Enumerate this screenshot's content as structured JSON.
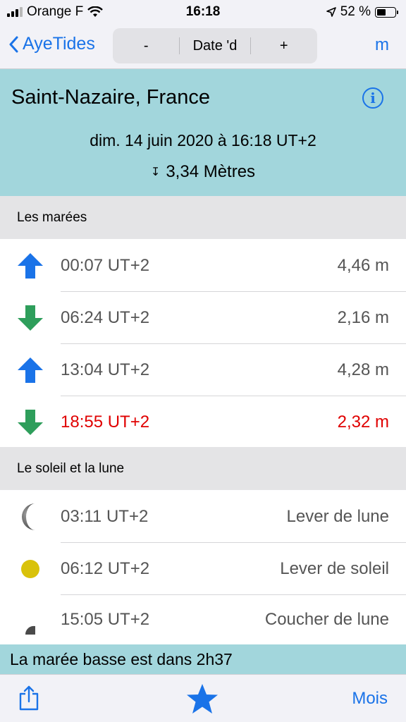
{
  "status_bar": {
    "carrier": "Orange F",
    "time": "16:18",
    "battery_percent": "52 %",
    "battery_level": 0.52
  },
  "nav": {
    "back_label": "AyeTides",
    "segments": [
      "-",
      "Date 'd",
      "+"
    ],
    "unit_label": "m"
  },
  "header": {
    "location": "Saint-Nazaire, France",
    "date": "dim. 14 juin 2020 à 16:18 UT+2",
    "height_glyph": "↧",
    "height": "3,34 Mètres"
  },
  "tides": {
    "section_title": "Les marées",
    "rows": [
      {
        "direction": "up",
        "icon": "arrow-up-icon",
        "time": "00:07 UT+2",
        "value": "4,46 m",
        "highlight": false
      },
      {
        "direction": "down",
        "icon": "arrow-down-icon",
        "time": "06:24 UT+2",
        "value": "2,16 m",
        "highlight": false
      },
      {
        "direction": "up",
        "icon": "arrow-up-icon",
        "time": "13:04 UT+2",
        "value": "4,28 m",
        "highlight": false
      },
      {
        "direction": "down",
        "icon": "arrow-down-icon",
        "time": "18:55 UT+2",
        "value": "2,32 m",
        "highlight": true
      }
    ]
  },
  "sun_moon": {
    "section_title": "Le soleil et la lune",
    "rows": [
      {
        "icon": "moon-icon",
        "time": "03:11 UT+2",
        "label": "Lever de lune"
      },
      {
        "icon": "sun-icon",
        "time": "06:12 UT+2",
        "label": "Lever de soleil"
      },
      {
        "icon": "moon-set-icon",
        "time": "15:05 UT+2",
        "label": "Coucher de lune"
      }
    ]
  },
  "banner": "La marée basse est dans 2h37",
  "toolbar": {
    "month_label": "Mois"
  },
  "colors": {
    "accent": "#1a73e8",
    "header_bg": "#a2d6dc",
    "arrow_up": "#1a73e8",
    "arrow_down": "#2e9e5b",
    "highlight": "#e00000",
    "sun": "#d9c20a"
  }
}
